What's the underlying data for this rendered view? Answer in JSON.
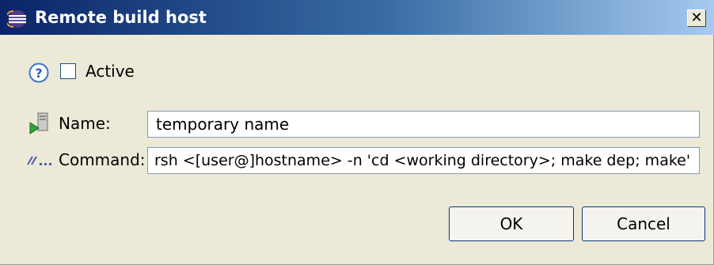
{
  "window": {
    "title": "Remote build host",
    "close_glyph": "✕"
  },
  "active": {
    "label": "Active",
    "checked": false
  },
  "name": {
    "label": "Name:",
    "value": "temporary name"
  },
  "command": {
    "label": "Command:",
    "value": "rsh <[user@]hostname> -n 'cd <working directory>; make dep; make'"
  },
  "buttons": {
    "ok_label": "OK",
    "cancel_label": "Cancel"
  },
  "icons": {
    "app": "eclipse-icon",
    "close": "close-icon",
    "help": "help-icon",
    "name": "computer-run-icon",
    "command": "command-icon"
  },
  "colors": {
    "titlebar_start": "#0a246a",
    "titlebar_end": "#a6caf0",
    "dialog_bg": "#ece9d8",
    "help_blue": "#3a78c8"
  }
}
